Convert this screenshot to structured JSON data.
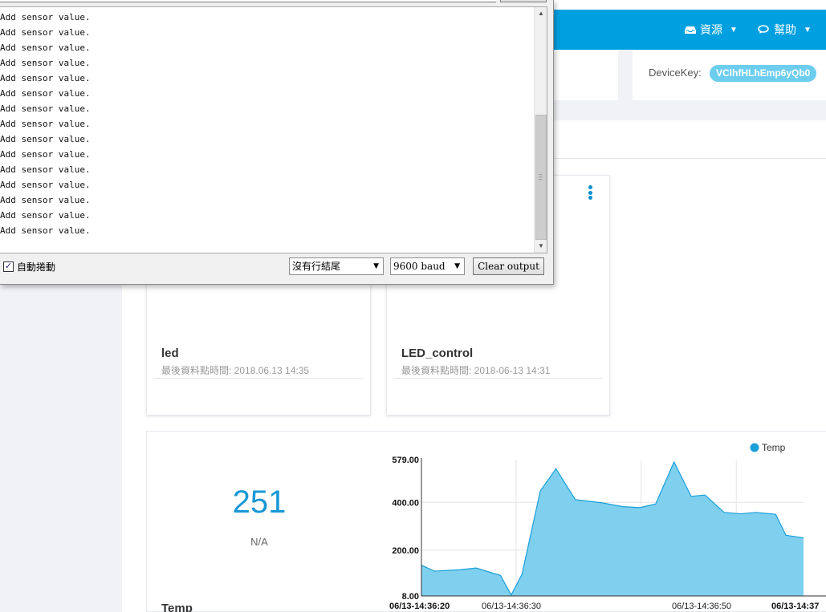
{
  "serial_monitor": {
    "output_lines": [
      "Add sensor value.",
      "Add sensor value.",
      "Add sensor value.",
      "Add sensor value.",
      "Add sensor value.",
      "Add sensor value.",
      "Add sensor value.",
      "Add sensor value.",
      "Add sensor value.",
      "Add sensor value.",
      "Add sensor value.",
      "Add sensor value.",
      "Add sensor value.",
      "Add sensor value.",
      "Add sensor value."
    ],
    "autoscroll": {
      "label": "自動捲動",
      "checked": true,
      "check_glyph": "✓"
    },
    "line_ending": {
      "selected": "沒有行結尾"
    },
    "baud_rate": {
      "selected": "9600 baud"
    },
    "clear_button": {
      "label": "Clear output"
    }
  },
  "topnav": {
    "resources": {
      "label": "資源",
      "icon": "inbox-icon"
    },
    "help": {
      "label": "幫助",
      "icon": "chat-icon"
    },
    "caret": "▼"
  },
  "device": {
    "key_label": "DeviceKey:",
    "key_value": "VClhfHLhEmp6yQb0"
  },
  "cards": [
    {
      "title": "led",
      "last_update": "最後資料點時間: 2018.06.13 14:35"
    },
    {
      "title": "LED_control",
      "last_update": "最後資料點時間: 2018-06-13 14:31"
    }
  ],
  "temp_card": {
    "value": "251",
    "unit": "N/A",
    "name": "Temp"
  },
  "colors": {
    "accent": "#00a0e0",
    "chart_fill": "#7fcfee",
    "chart_line": "#1a9fd8",
    "value_text": "#1898d5"
  },
  "chart_data": {
    "type": "area",
    "legend": {
      "name": "Temp",
      "position": "top-right"
    },
    "y_ticks": [
      "579.00",
      "400.00",
      "200.00",
      "8.00"
    ],
    "ylim": [
      8,
      579
    ],
    "x_ticks_bold": [
      "06/13-14:36:20",
      "06/13-14:37"
    ],
    "x_ticks": [
      "06/13-14:36:30",
      "06/13-14:36:50"
    ],
    "grid": true,
    "series": [
      {
        "name": "Temp",
        "x": [
          "14:36:20",
          "14:36:21",
          "14:36:22",
          "14:36:23",
          "14:36:24",
          "14:36:25",
          "14:36:26",
          "14:36:27",
          "14:36:28",
          "14:36:29",
          "14:36:30",
          "14:36:31",
          "14:36:32",
          "14:36:33",
          "14:36:34",
          "14:36:35",
          "14:36:36",
          "14:36:37",
          "14:36:38",
          "14:36:39",
          "14:36:40",
          "14:36:41",
          "14:36:42",
          "14:36:43",
          "14:36:44",
          "14:36:45",
          "14:36:46",
          "14:36:47",
          "14:36:48",
          "14:36:49",
          "14:36:50",
          "14:36:51",
          "14:36:52",
          "14:36:53",
          "14:36:54",
          "14:36:55",
          "14:36:56",
          "14:36:57",
          "14:36:58",
          "14:36:59",
          "14:37:00",
          "14:37:01"
        ],
        "values": [
          137,
          null,
          112,
          null,
          null,
          null,
          null,
          125,
          null,
          null,
          10,
          null,
          null,
          null,
          null,
          null,
          null,
          null,
          null,
          null,
          null,
          null,
          null,
          null,
          null,
          null,
          null,
          null,
          null,
          null,
          null,
          null,
          null,
          null,
          null,
          null,
          null,
          null,
          null,
          null,
          null,
          null
        ]
      }
    ]
  },
  "chart_points": {
    "note_x": "x positions as fractions of plot width, y as data values",
    "x": [
      0,
      0.034,
      0.102,
      0.143,
      0.207,
      0.235,
      0.263,
      0.311,
      0.352,
      0.403,
      0.473,
      0.527,
      0.571,
      0.613,
      0.661,
      0.706,
      0.742,
      0.792,
      0.835,
      0.875,
      0.927,
      0.954,
      1.0
    ],
    "y": [
      137,
      112,
      118,
      125,
      94,
      12,
      98,
      447,
      541,
      411,
      398,
      382,
      378,
      393,
      569,
      425,
      431,
      358,
      352,
      358,
      350,
      262,
      251
    ]
  }
}
